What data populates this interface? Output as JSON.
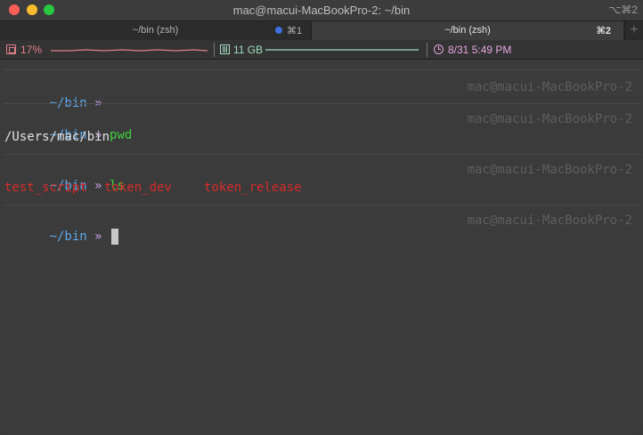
{
  "window": {
    "title": "mac@macui-MacBookPro-2: ~/bin",
    "shortcut": "⌥⌘2"
  },
  "tabs": [
    {
      "label": "~/bin (zsh)",
      "shortcut": "⌘1",
      "active": false
    },
    {
      "label": "~/bin (zsh)",
      "shortcut": "⌘2",
      "active": true
    }
  ],
  "newtab": {
    "label": "+"
  },
  "statusbar": {
    "cpu": {
      "text": "17%",
      "color": "#e0808a"
    },
    "memory": {
      "text": "11 GB",
      "color": "#a4dcc0"
    },
    "clock": {
      "text": "8/31 5:49 PM",
      "color": "#e6a6e0"
    }
  },
  "terminal": {
    "host": "mac@macui-MacBookPro-2",
    "prompt_cwd": "~/bin",
    "prompt_arrow": "»",
    "blocks": [
      {
        "command": "",
        "output": ""
      },
      {
        "command": "pwd",
        "output": "/Users/mac/bin"
      },
      {
        "command": "ls",
        "output_items": [
          "test_script",
          "token_dev",
          "token_release"
        ]
      },
      {
        "command": ""
      }
    ]
  },
  "colors": {
    "prompt_cwd": "#5fa8e8",
    "prompt_arrow": "#c8a0e6",
    "command": "#3fcf3f",
    "ls_file": "#d62b2b",
    "active_tab_dot": "#3f6fe0"
  }
}
